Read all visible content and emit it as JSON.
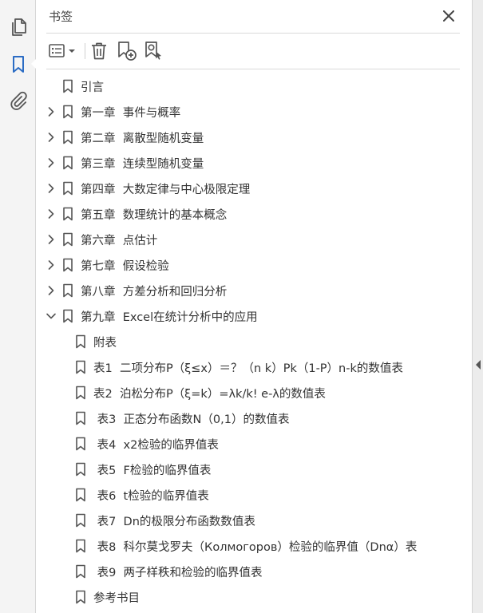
{
  "panel": {
    "title": "书签"
  },
  "toolbar": {
    "options_icon": "options-menu-icon",
    "delete_icon": "trash-icon",
    "new_icon": "new-bookmark-icon",
    "find_icon": "find-bookmark-icon"
  },
  "rail": {
    "items": [
      "page-thumbnails-icon",
      "bookmark-icon",
      "attachment-icon"
    ],
    "active": "bookmark-icon"
  },
  "colors": {
    "accent": "#2b6cc4",
    "text": "#333333",
    "icon": "#555555"
  },
  "tree": [
    {
      "label": "引言",
      "level": 0,
      "expander": "none"
    },
    {
      "label": "第一章  事件与概率",
      "level": 0,
      "expander": "collapsed"
    },
    {
      "label": "第二章  离散型随机变量",
      "level": 0,
      "expander": "collapsed"
    },
    {
      "label": "第三章  连续型随机变量",
      "level": 0,
      "expander": "collapsed"
    },
    {
      "label": "第四章  大数定律与中心极限定理",
      "level": 0,
      "expander": "collapsed"
    },
    {
      "label": "第五章  数理统计的基本概念",
      "level": 0,
      "expander": "collapsed"
    },
    {
      "label": "第六章  点估计",
      "level": 0,
      "expander": "collapsed"
    },
    {
      "label": "第七章  假设检验",
      "level": 0,
      "expander": "collapsed"
    },
    {
      "label": "第八章  方差分析和回归分析",
      "level": 0,
      "expander": "collapsed"
    },
    {
      "label": "第九章  Excel在统计分析中的应用",
      "level": 0,
      "expander": "expanded"
    },
    {
      "label": "附表",
      "level": 1,
      "expander": "none"
    },
    {
      "label": "表1  二项分布P（ξ≤x）＝？（n k）Pk（1-P）n-k的数值表",
      "level": 1,
      "expander": "none"
    },
    {
      "label": "表2  泊松分布P（ξ=k）=λk/k! e-λ的数值表",
      "level": 1,
      "expander": "none"
    },
    {
      "label": " 表3  正态分布函数N（0,1）的数值表",
      "level": 1,
      "expander": "none"
    },
    {
      "label": " 表4  x2检验的临界值表",
      "level": 1,
      "expander": "none"
    },
    {
      "label": " 表5  F检验的临界值表",
      "level": 1,
      "expander": "none"
    },
    {
      "label": " 表6  t检验的临界值表",
      "level": 1,
      "expander": "none"
    },
    {
      "label": " 表7  Dn的极限分布函数数值表",
      "level": 1,
      "expander": "none"
    },
    {
      "label": " 表8  科尔莫戈罗夫（Колмогоров）检验的临界值（Dnα）表",
      "level": 1,
      "expander": "none"
    },
    {
      "label": " 表9  两子样秩和检验的临界值表",
      "level": 1,
      "expander": "none"
    },
    {
      "label": "参考书目",
      "level": 1,
      "expander": "none"
    }
  ]
}
